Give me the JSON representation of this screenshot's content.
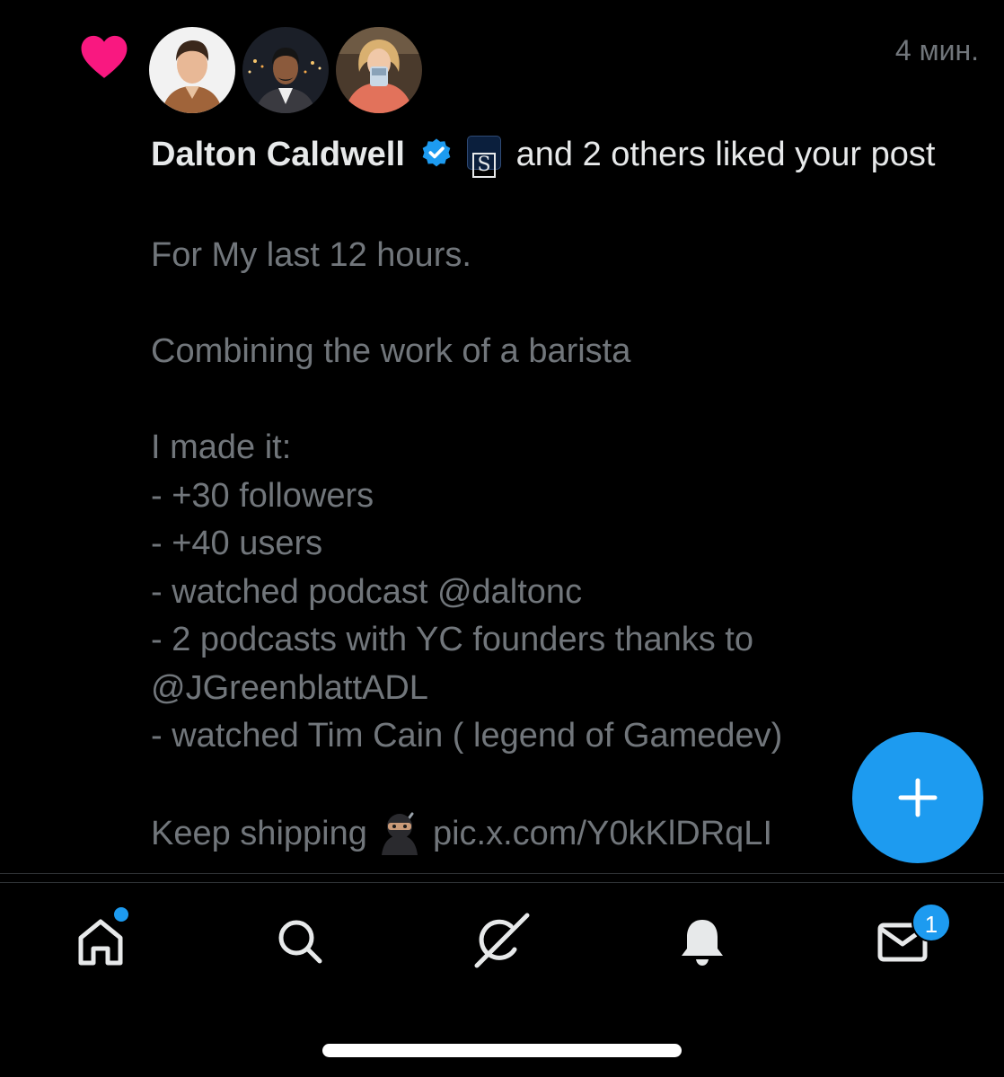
{
  "notification": {
    "icon": "heart-icon",
    "avatars": [
      "avatar-1",
      "avatar-2",
      "avatar-3"
    ],
    "time": "4 мин.",
    "liker_name": "Dalton Caldwell",
    "liked_text": "and 2 others liked your post",
    "post_lines": [
      "For My last 12 hours.",
      "",
      "Combining the work of a barista",
      "",
      "I made it:",
      "- +30 followers",
      "- +40 users",
      "-  watched podcast @daltonc",
      "- 2 podcasts with YC founders thanks to",
      "@JGreenblattADL",
      "- watched Tim Cain ( legend of Gamedev)",
      "",
      "Keep shipping"
    ],
    "post_link": "pic.x.com/Y0kKlDRqLI"
  },
  "fab": {
    "icon": "plus-icon"
  },
  "nav": {
    "items": [
      {
        "icon": "home-icon"
      },
      {
        "icon": "search-icon"
      },
      {
        "icon": "grok-icon"
      },
      {
        "icon": "bell-icon"
      },
      {
        "icon": "mail-icon"
      }
    ],
    "messages_badge": "1"
  },
  "colors": {
    "accent": "#1d9bf0",
    "heart": "#f91880",
    "muted": "#71767b"
  }
}
